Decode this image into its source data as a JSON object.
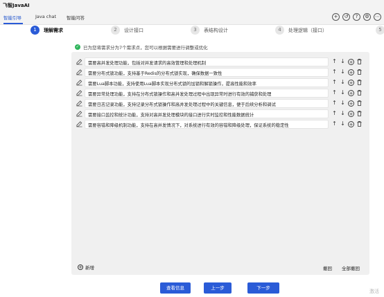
{
  "app": {
    "title": "飞智JavaAI"
  },
  "tabs": [
    {
      "label": "智能引导",
      "active": true
    },
    {
      "label": "Java chat",
      "active": false
    },
    {
      "label": "智能问答",
      "active": false
    }
  ],
  "top_icons": [
    "add-circle-icon",
    "history-icon",
    "help-icon",
    "settings-icon",
    "more-icon"
  ],
  "steps": [
    {
      "num": "1",
      "label": "理解需求",
      "active": true
    },
    {
      "num": "2",
      "label": "设计接口",
      "active": false
    },
    {
      "num": "3",
      "label": "表结构设计",
      "active": false
    },
    {
      "num": "4",
      "label": "处理逻辑（接口）",
      "active": false
    },
    {
      "num": "5",
      "label": "",
      "active": false
    }
  ],
  "notice": "已为您将需求分为7个需求点，您可以根据需要进行调整或优化",
  "requirements": [
    "需要高并发处理功能，包括对并发请求的高效管理和处理机制",
    "需要分布式锁功能，支持基于Redis的分布式锁实现，确保数据一致性",
    "需要Lua脚本功能，支持使用Lua脚本实现分布式锁的加锁和解锁操作，提高性能和效率",
    "需要异常处理功能，支持在分布式锁操作和高并发处理过程中出现异常时进行有效的捕获和处理",
    "需要日志记录功能，支持记录分布式锁操作和高并发处理过程中的关键信息，便于后续分析和调试",
    "需要接口监控和统计功能，支持对高并发处理模块的接口进行实时监控和性能数据统计",
    "需要容错和降级机制功能，支持在高并发情况下，对系统进行有效的容错和降级处理，保证系统的稳定性"
  ],
  "row_action_icons": [
    "arrow-up-icon",
    "arrow-down-icon",
    "add-circle-icon",
    "delete-icon"
  ],
  "footer": {
    "add_label": "新增",
    "undo_label": "撤回",
    "undo_all_label": "全部撤回"
  },
  "buttons": {
    "view_info": "查看信息",
    "prev": "上一步",
    "next": "下一步"
  },
  "watermark": "激活"
}
